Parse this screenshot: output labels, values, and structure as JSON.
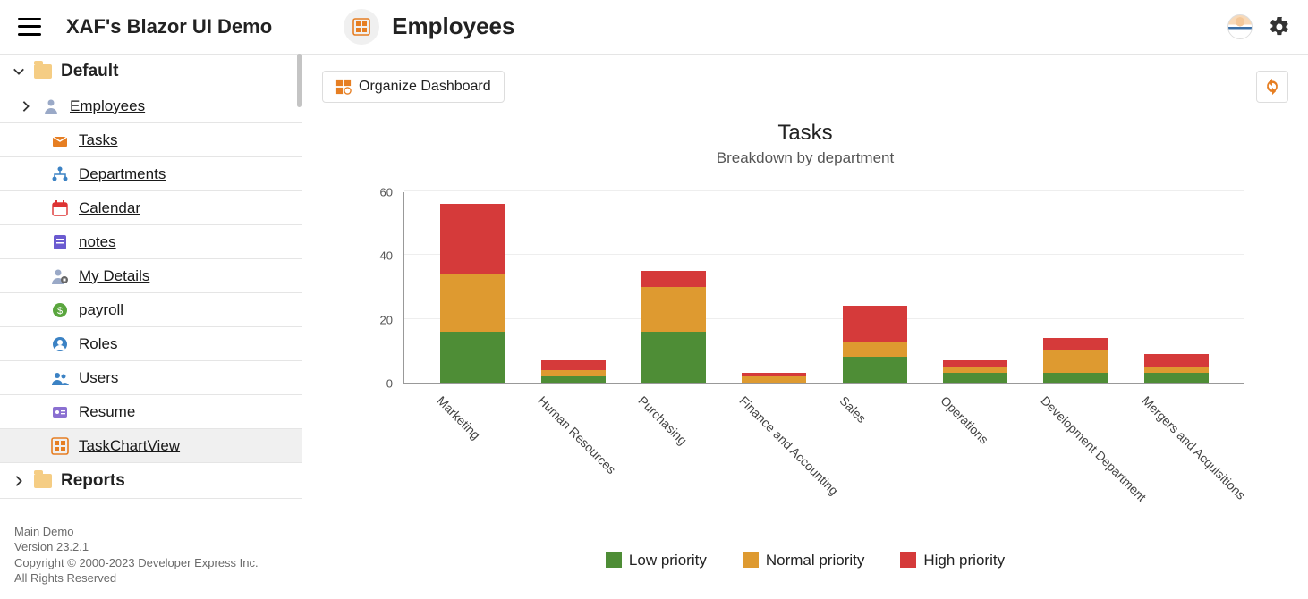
{
  "header": {
    "app_title": "XAF's Blazor UI Demo",
    "page_title": "Employees"
  },
  "sidebar": {
    "groups": [
      {
        "label": "Default",
        "expanded": true
      },
      {
        "label": "Reports",
        "expanded": false
      }
    ],
    "items": [
      {
        "label": "Employees",
        "icon": "person",
        "has_children": true
      },
      {
        "label": "Tasks",
        "icon": "inbox"
      },
      {
        "label": "Departments",
        "icon": "org"
      },
      {
        "label": "Calendar",
        "icon": "calendar"
      },
      {
        "label": "notes",
        "icon": "note"
      },
      {
        "label": "My Details",
        "icon": "lock-person"
      },
      {
        "label": "payroll",
        "icon": "money"
      },
      {
        "label": "Roles",
        "icon": "role"
      },
      {
        "label": "Users",
        "icon": "users"
      },
      {
        "label": "Resume",
        "icon": "card"
      },
      {
        "label": "TaskChartView",
        "icon": "dashboard",
        "selected": true
      }
    ],
    "footer": {
      "line1": "Main Demo",
      "line2": "Version 23.2.1",
      "line3": "Copyright © 2000-2023 Developer Express Inc.",
      "line4": "All Rights Reserved"
    }
  },
  "toolbar": {
    "organize_label": "Organize Dashboard"
  },
  "chart_data": {
    "type": "bar",
    "title": "Tasks",
    "subtitle": "Breakdown by department",
    "ylabel": "",
    "ylim": [
      0,
      60
    ],
    "yticks": [
      0,
      20,
      40,
      60
    ],
    "categories": [
      "Marketing",
      "Human Resources",
      "Purchasing",
      "Finance and Accounting",
      "Sales",
      "Operations",
      "Development Department",
      "Mergers and Acquisitions"
    ],
    "series": [
      {
        "name": "Low priority",
        "color": "#4e8d36",
        "values": [
          16,
          2,
          16,
          0,
          8,
          3,
          3,
          3
        ]
      },
      {
        "name": "Normal priority",
        "color": "#de9a30",
        "values": [
          18,
          2,
          14,
          2,
          5,
          2,
          7,
          2
        ]
      },
      {
        "name": "High priority",
        "color": "#d53a3a",
        "values": [
          22,
          3,
          5,
          1,
          11,
          2,
          4,
          4
        ]
      }
    ]
  },
  "colors": {
    "accent": "#e67e22",
    "green": "#4e8d36",
    "orange": "#de9a30",
    "red": "#d53a3a"
  }
}
